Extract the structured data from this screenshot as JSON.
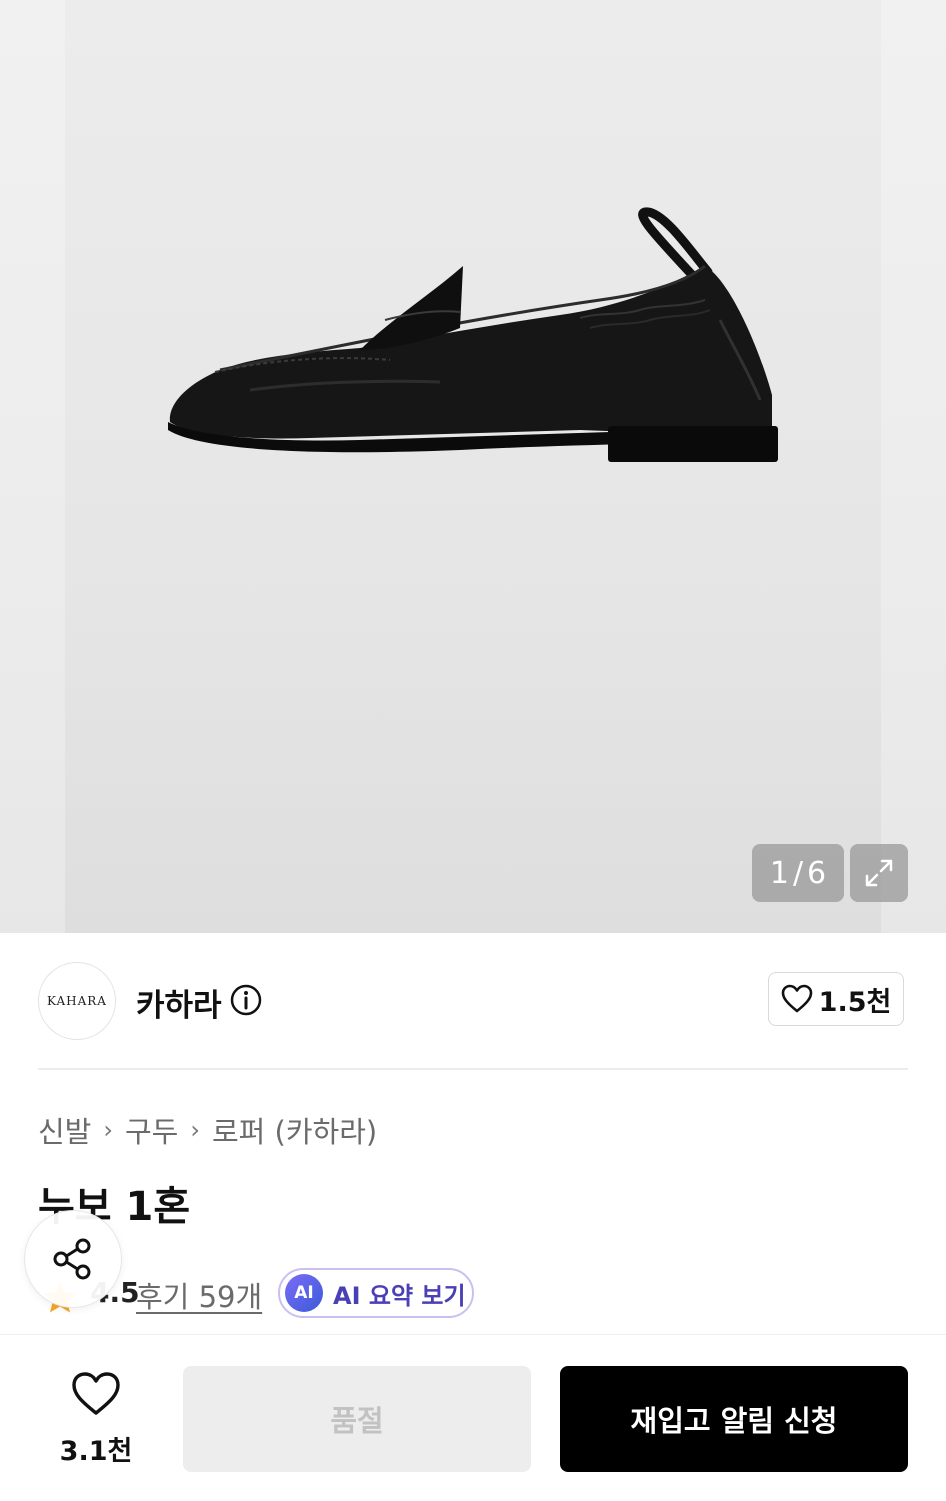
{
  "gallery": {
    "current": "1",
    "separator": "/",
    "total": "6",
    "expand_icon": "expand-arrows-icon"
  },
  "brand": {
    "logo_text": "KAHARA",
    "name": "카하라",
    "info_icon": "info-circle-icon",
    "like_count": "1.5천"
  },
  "breadcrumb": [
    "신발",
    "구두",
    "로퍼 (카하라)"
  ],
  "product": {
    "title": "누보 1혼"
  },
  "rating": {
    "value": "4.5",
    "reviews": "후기 59개",
    "ai_badge": "AI",
    "ai_label": "AI 요약 보기"
  },
  "bottom_bar": {
    "wish_count": "3.1천",
    "soldout_label": "품절",
    "restock_label": "재입고 알림 신청"
  },
  "colors": {
    "accent_ai": "#4a3fb5",
    "star": "#f5a623",
    "primary_button": "#000000"
  }
}
